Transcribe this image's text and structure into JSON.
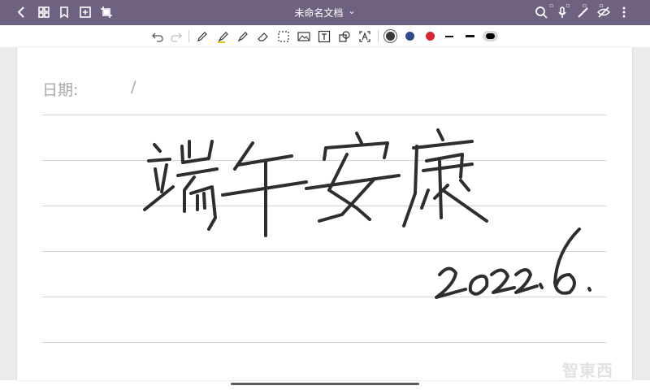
{
  "app": {
    "title": "未命名文档",
    "title_chevron": "⌄",
    "nav": [
      "back-icon",
      "grid-icon",
      "bookmark-icon",
      "add-page-icon",
      "crop-icon"
    ],
    "right_tools": [
      "search-icon",
      "microphone-icon",
      "pen-icon",
      "hide-icon",
      "more-icon"
    ]
  },
  "toolbar": {
    "tools": [
      "undo-icon",
      "redo-icon",
      "pencil-icon",
      "highlighter-icon",
      "marker-icon",
      "eraser-icon",
      "lasso-icon",
      "image-icon",
      "text-box-icon",
      "shape-icon",
      "text-recognize-icon"
    ],
    "colors": [
      "#3a3a3a",
      "#2d4a8a",
      "#d9252f"
    ],
    "selected_color": "#3a3a3a",
    "stroke_widths": [
      "thin",
      "medium",
      "thick"
    ],
    "selected_stroke": "thick"
  },
  "page": {
    "date_label": "日期:",
    "date_separator": "/",
    "handwriting": {
      "main_text": "端午安康",
      "date_text": "2022.6."
    }
  },
  "watermark": "智東西"
}
